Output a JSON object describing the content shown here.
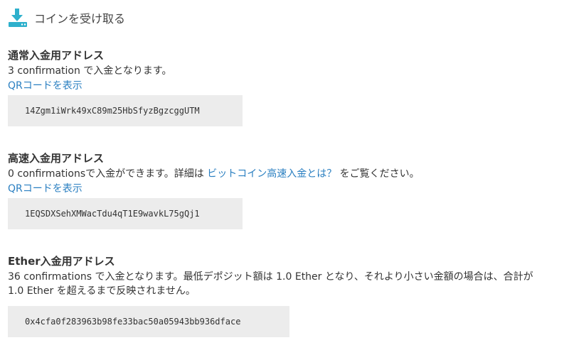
{
  "header": {
    "icon": "download-icon",
    "title": "コインを受け取る",
    "icon_color": "#2eb0cc"
  },
  "normal": {
    "title": "通常入金用アドレス",
    "description": "3 confirmation で入金となります。",
    "qr_link": "QRコードを表示",
    "address": "14Zgm1iWrk49xC89m25HbSfyzBgzcggUTM"
  },
  "fast": {
    "title": "高速入金用アドレス",
    "description_prefix": "0 confirmationsで入金ができます。詳細は",
    "help_link": "ビットコイン高速入金とは？",
    "description_suffix": "をご覧ください。",
    "qr_link": "QRコードを表示",
    "address": "1EQSDXSehXMWacTdu4qT1E9wavkL75gQj1"
  },
  "ether": {
    "title": "Ether入金用アドレス",
    "description": "36 confirmations で入金となります。最低デポジット額は 1.0 Ether となり、それより小さい金額の場合は、合計が 1.0 Ether を超えるまで反映されません。",
    "address": "0x4cfa0f283963b98fe33bac50a05943bb936dface"
  },
  "colors": {
    "link": "#2a7fc1",
    "address_bg": "#ececec"
  }
}
